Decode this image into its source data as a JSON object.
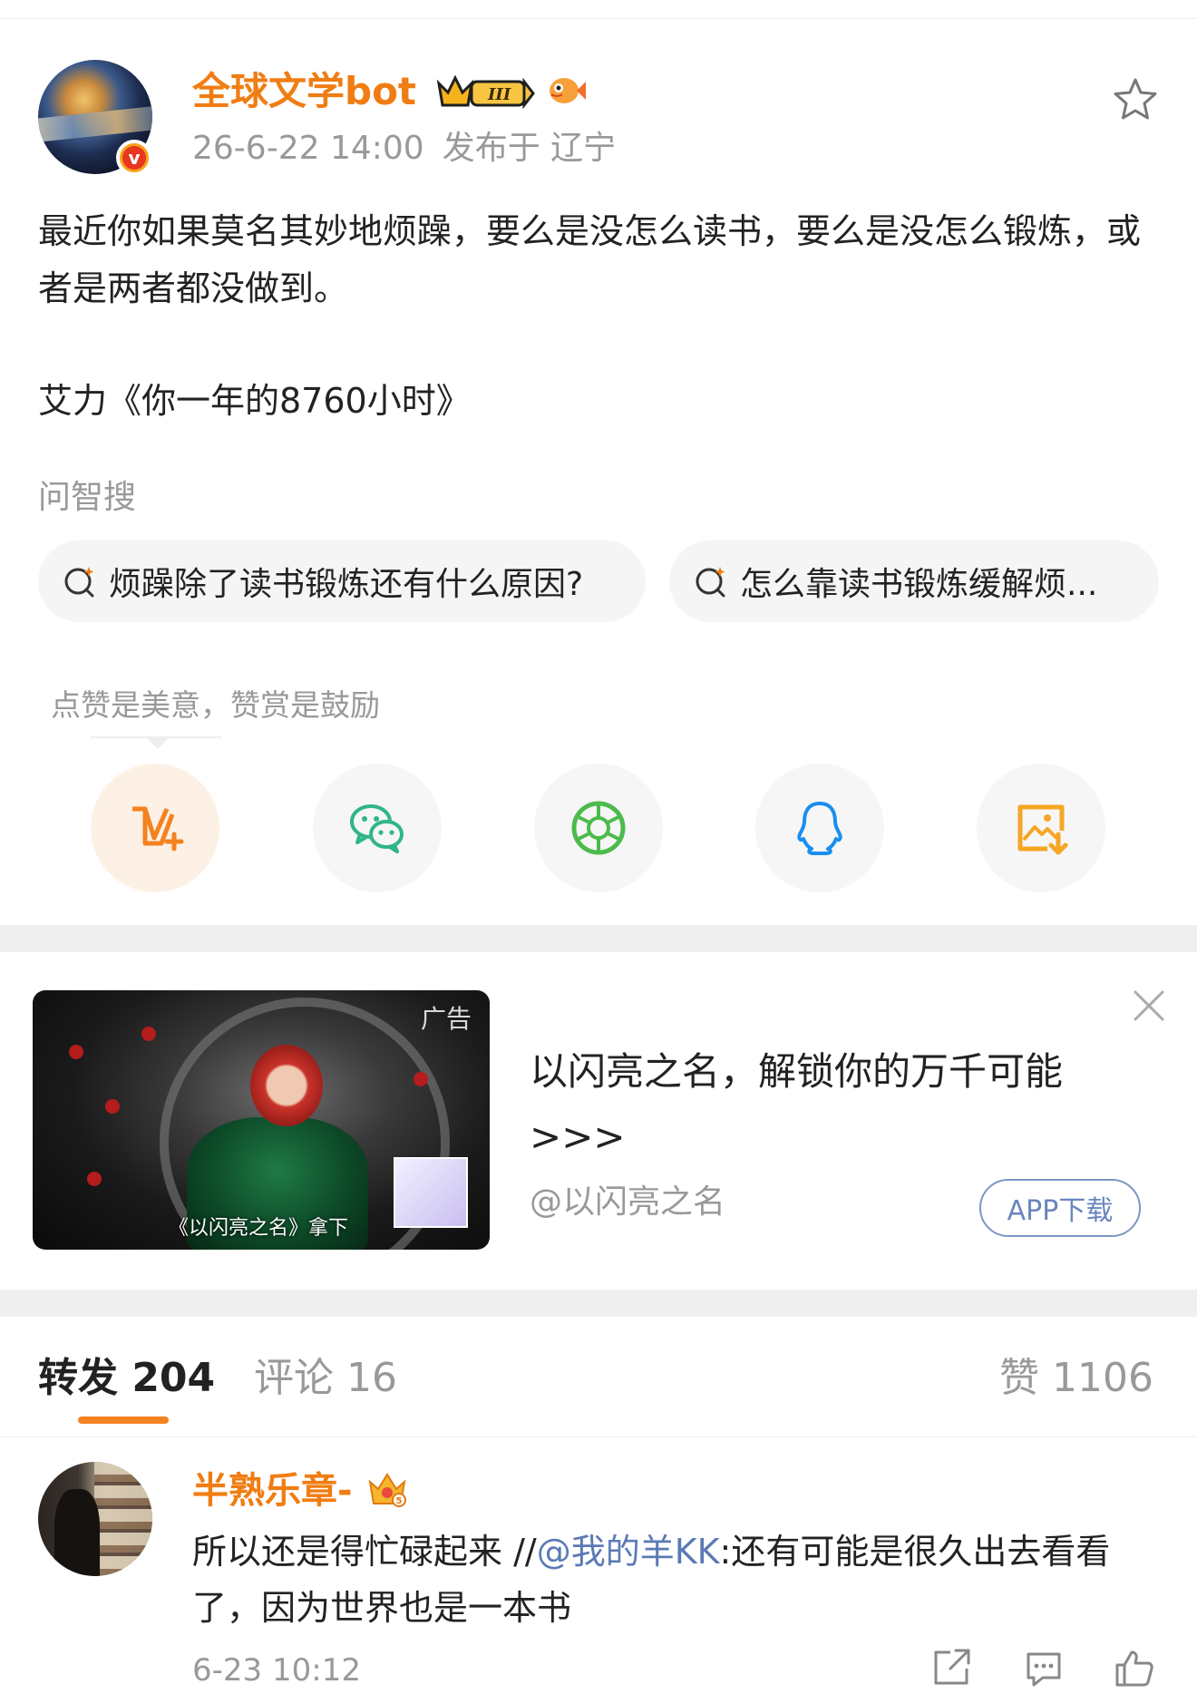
{
  "post": {
    "username": "全球文学bot",
    "timestamp": "26-6-22 14:00",
    "location": "发布于 辽宁",
    "body": "最近你如果莫名其妙地烦躁，要么是没怎么读书，要么是没怎么锻炼，或者是两者都没做到。",
    "quote": "艾力《你一年的8760小时》",
    "icons": [
      "verified-badge-icon",
      "vip-crown-icon",
      "fish-icon",
      "star-icon"
    ]
  },
  "ask": {
    "label": "问智搜",
    "chips": [
      "烦躁除了读书锻炼还有什么原因?",
      "怎么靠读书锻炼缓解烦..."
    ]
  },
  "share": {
    "tip": "点赞是美意，赞赏是鼓励",
    "buttons": [
      "reward-icon",
      "wechat-icon",
      "moments-icon",
      "qq-icon",
      "save-image-icon"
    ]
  },
  "ad": {
    "tag": "广告",
    "caption": "《以闪亮之名》拿下",
    "title": "以闪亮之名，解锁你的万千可能 >>>",
    "account": "@以闪亮之名",
    "button": "APP下载"
  },
  "tabs": {
    "repost": "转发 204",
    "comment": "评论 16",
    "like": "赞 1106"
  },
  "comment": {
    "name": "半熟乐章-",
    "text_prefix": "所以还是得忙碌起来 //",
    "mention": "@我的羊KK",
    "text_suffix": ":还有可能是很久出去看看了，因为世界也是一本书",
    "time": "6-23 10:12"
  },
  "colors": {
    "accent": "#f07d13",
    "link": "#5b7ab4",
    "muted": "#999999",
    "wechat": "#2fb589",
    "moments": "#4cbb4c",
    "qq": "#1a8ef0",
    "save": "#f5a623"
  }
}
